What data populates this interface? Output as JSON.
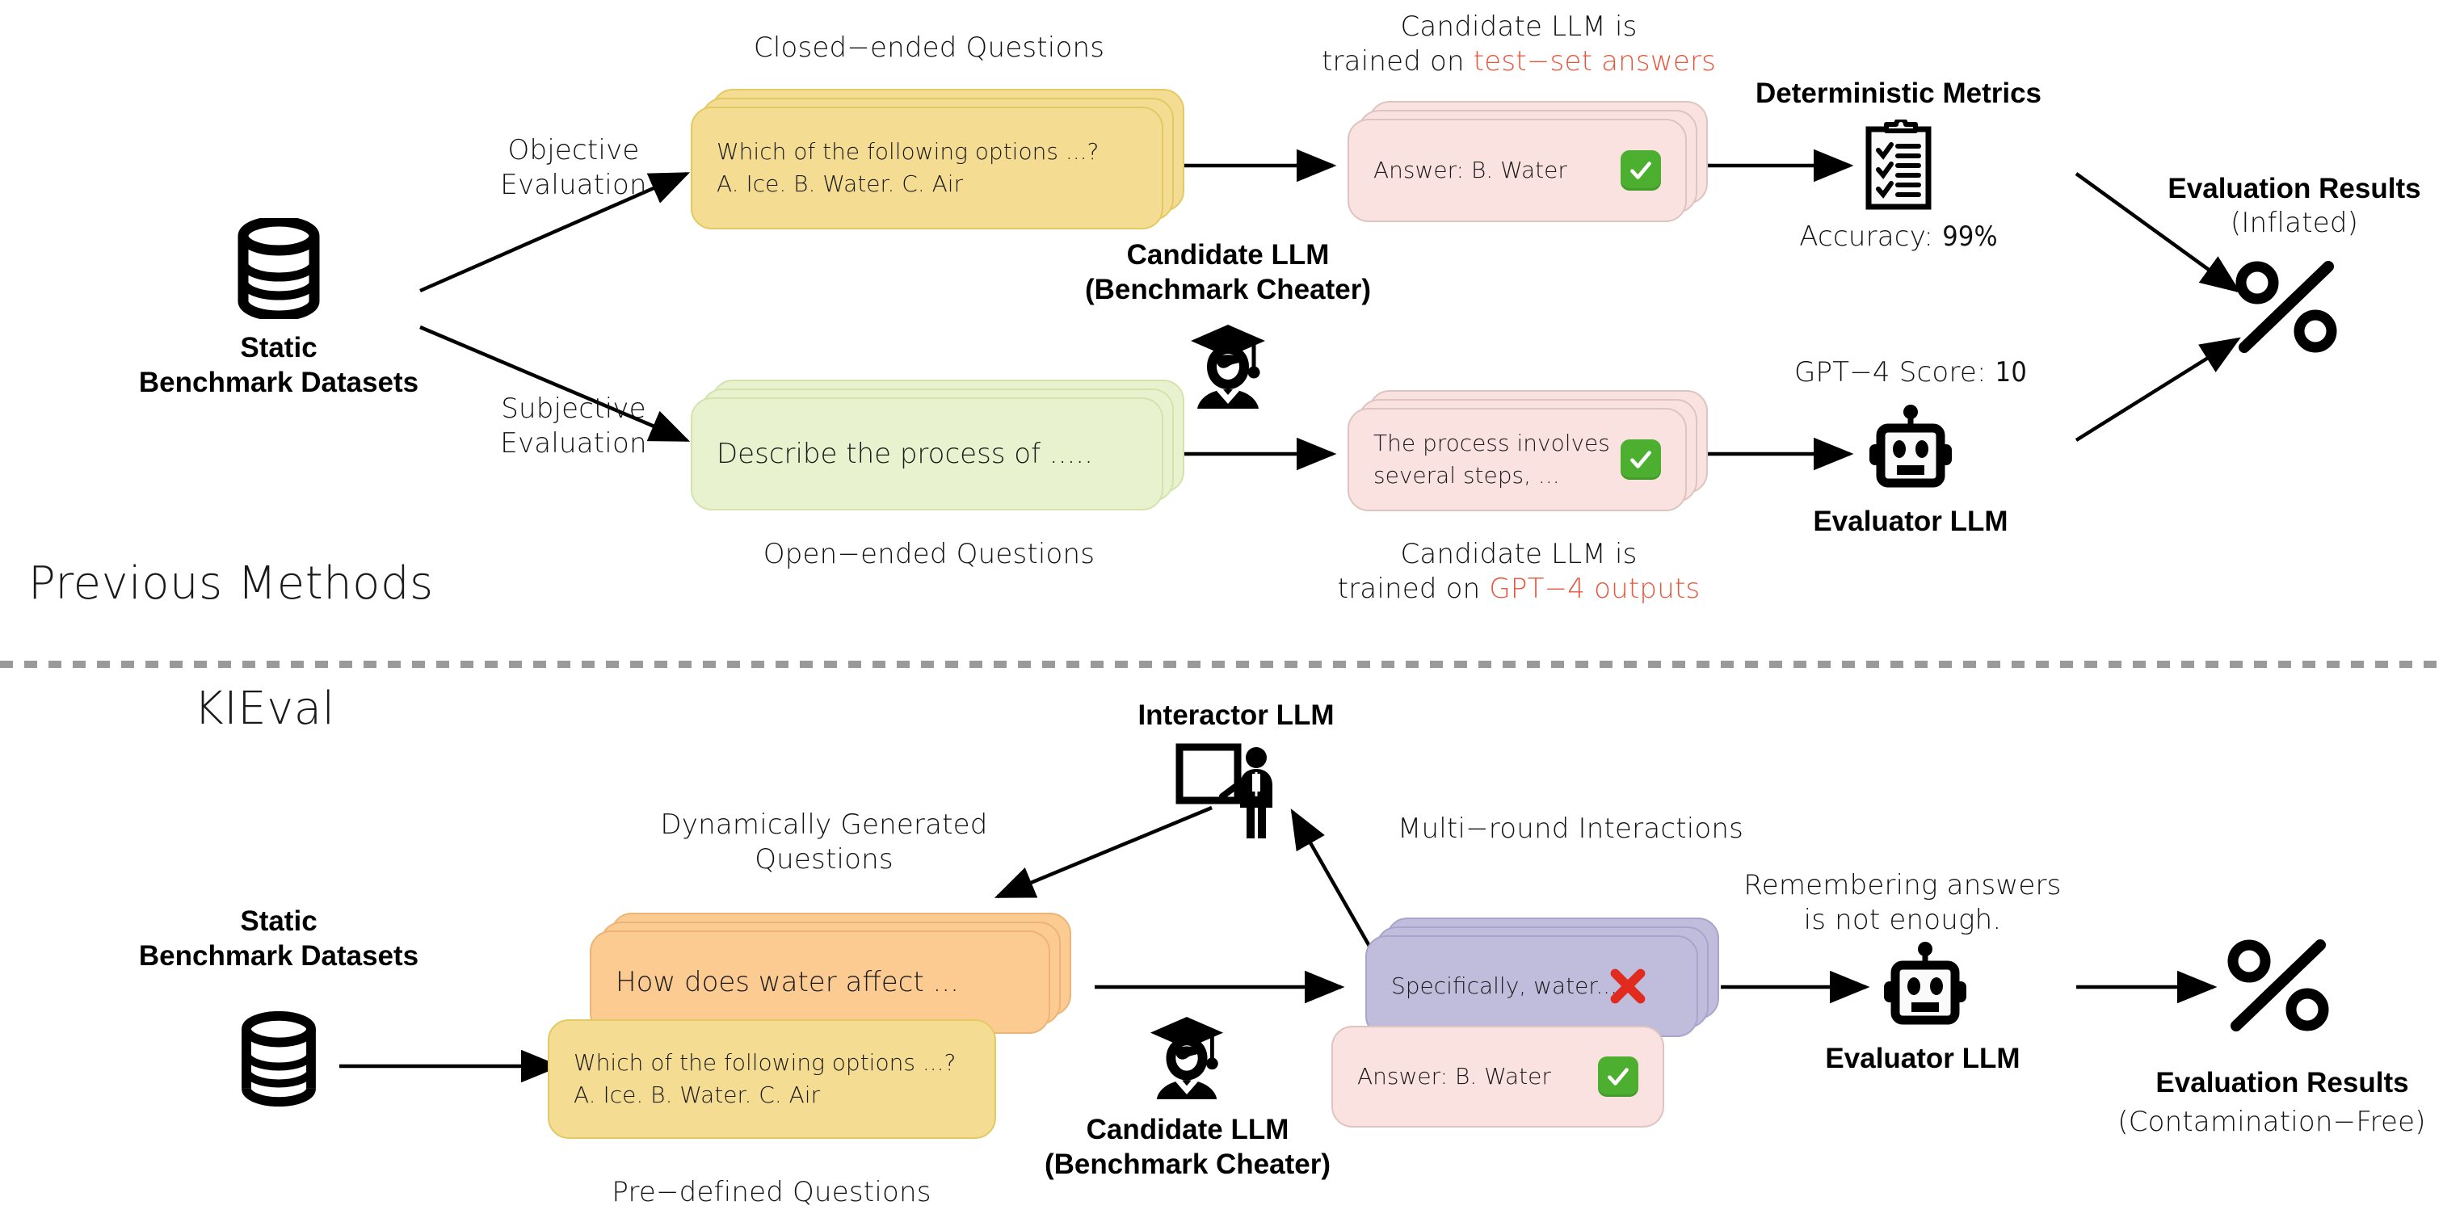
{
  "sections": {
    "previous": "Previous Methods",
    "kieval": "KIEval"
  },
  "top": {
    "dataset": {
      "line1": "Static",
      "line2": "Benchmark Datasets",
      "icon": "database-icon"
    },
    "branch_objective": {
      "line1": "Objective",
      "line2": "Evaluation"
    },
    "branch_subjective": {
      "line1": "Subjective",
      "line2": "Evaluation"
    },
    "closed_label": "Closed−ended Questions",
    "closed_card": {
      "line1": "Which of the following options ...?",
      "line2": "A. Ice. B. Water. C. Air"
    },
    "open_card": {
      "line1": "Describe the process of ....."
    },
    "open_label": "Open−ended Questions",
    "candidate": {
      "line1": "Candidate LLM",
      "line2": "(Benchmark Cheater)",
      "icon": "graduate-icon"
    },
    "answer_card_1": {
      "caption_line1": "Candidate LLM is",
      "caption_prefix": "trained on ",
      "caption_highlight": "test−set answers",
      "text": "Answer: B. Water",
      "badge": "check-badge"
    },
    "answer_card_2": {
      "text_line1": "The process involves",
      "text_line2": "several steps, ...",
      "badge": "check-badge",
      "caption_line1": "Candidate LLM is",
      "caption_prefix": "trained on ",
      "caption_highlight": "GPT−4 outputs"
    },
    "metrics": {
      "title": "Deterministic Metrics",
      "icon": "clipboard-checklist-icon",
      "value_prefix": "Accuracy: ",
      "value": "99%"
    },
    "evaluator": {
      "score_prefix": "GPT−4 Score: ",
      "score": "10",
      "icon": "robot-icon",
      "label": "Evaluator LLM"
    },
    "results": {
      "line1": "Evaluation Results",
      "line2": "(Inflated)",
      "icon": "percent-icon"
    }
  },
  "bottom": {
    "dataset": {
      "line1": "Static",
      "line2": "Benchmark Datasets",
      "icon": "database-icon"
    },
    "interactor": {
      "label": "Interactor LLM",
      "icon": "presenter-icon"
    },
    "dyn_questions": {
      "line1": "Dynamically Generated",
      "line2": "Questions"
    },
    "multi_round": "Multi−round Interactions",
    "dyn_card": {
      "text": "How does water affect ..."
    },
    "predef_card": {
      "line1": "Which of the following options ...?",
      "line2": "A. Ice. B. Water. C. Air"
    },
    "predef_label": "Pre−defined Questions",
    "candidate": {
      "line1": "Candidate LLM",
      "line2": "(Benchmark Cheater)",
      "icon": "graduate-icon"
    },
    "resp_purple": {
      "text": "Specifically, water...",
      "badge": "cross-badge"
    },
    "resp_pink": {
      "text": "Answer: B. Water",
      "badge": "check-badge"
    },
    "remember": {
      "line1": "Remembering answers",
      "line2": "is not enough."
    },
    "evaluator": {
      "icon": "robot-icon",
      "label": "Evaluator LLM"
    },
    "results": {
      "line1": "Evaluation Results",
      "line2": "(Contamination−Free)",
      "icon": "percent-icon"
    }
  },
  "colors": {
    "yellow_card": "#f4dd92",
    "green_card": "#e8f2ce",
    "pink_card": "#f9e2df",
    "orange_card": "#fbcb92",
    "purple_card": "#c0bcdc",
    "highlight_red": "#e8553a",
    "check_green": "#4caf2f",
    "cross_red": "#e12b1f"
  }
}
